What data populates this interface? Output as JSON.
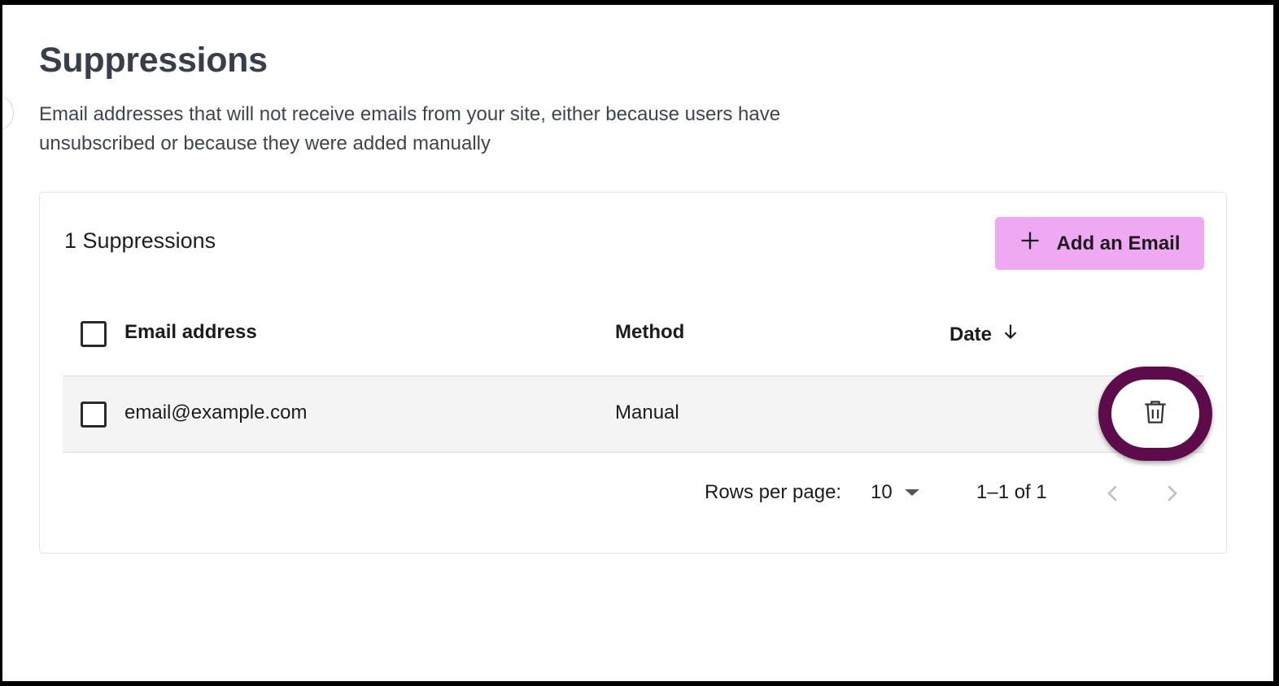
{
  "page": {
    "title": "Suppressions",
    "description": "Email addresses that will not receive emails from your site, either because users have unsubscribed or because they were added manually"
  },
  "card": {
    "count_label": "1 Suppressions",
    "add_button_label": "Add an Email",
    "add_icon": "plus-icon"
  },
  "table": {
    "columns": [
      "Email address",
      "Method",
      "Date"
    ],
    "sort_icon": "arrow-down-icon",
    "rows": [
      {
        "email": "email@example.com",
        "method": "Manual",
        "date": "",
        "action_icon": "trash-icon"
      }
    ]
  },
  "pagination": {
    "rows_per_page_label": "Rows per page:",
    "rows_per_page_value": "10",
    "range_label": "1–1 of 1",
    "prev_icon": "chevron-left-icon",
    "next_icon": "chevron-right-icon"
  },
  "colors": {
    "accent_button": "#efa9f3",
    "highlight_ring": "#5e0b4b",
    "title_text": "#37404a",
    "row_background": "#f4f4f4"
  }
}
